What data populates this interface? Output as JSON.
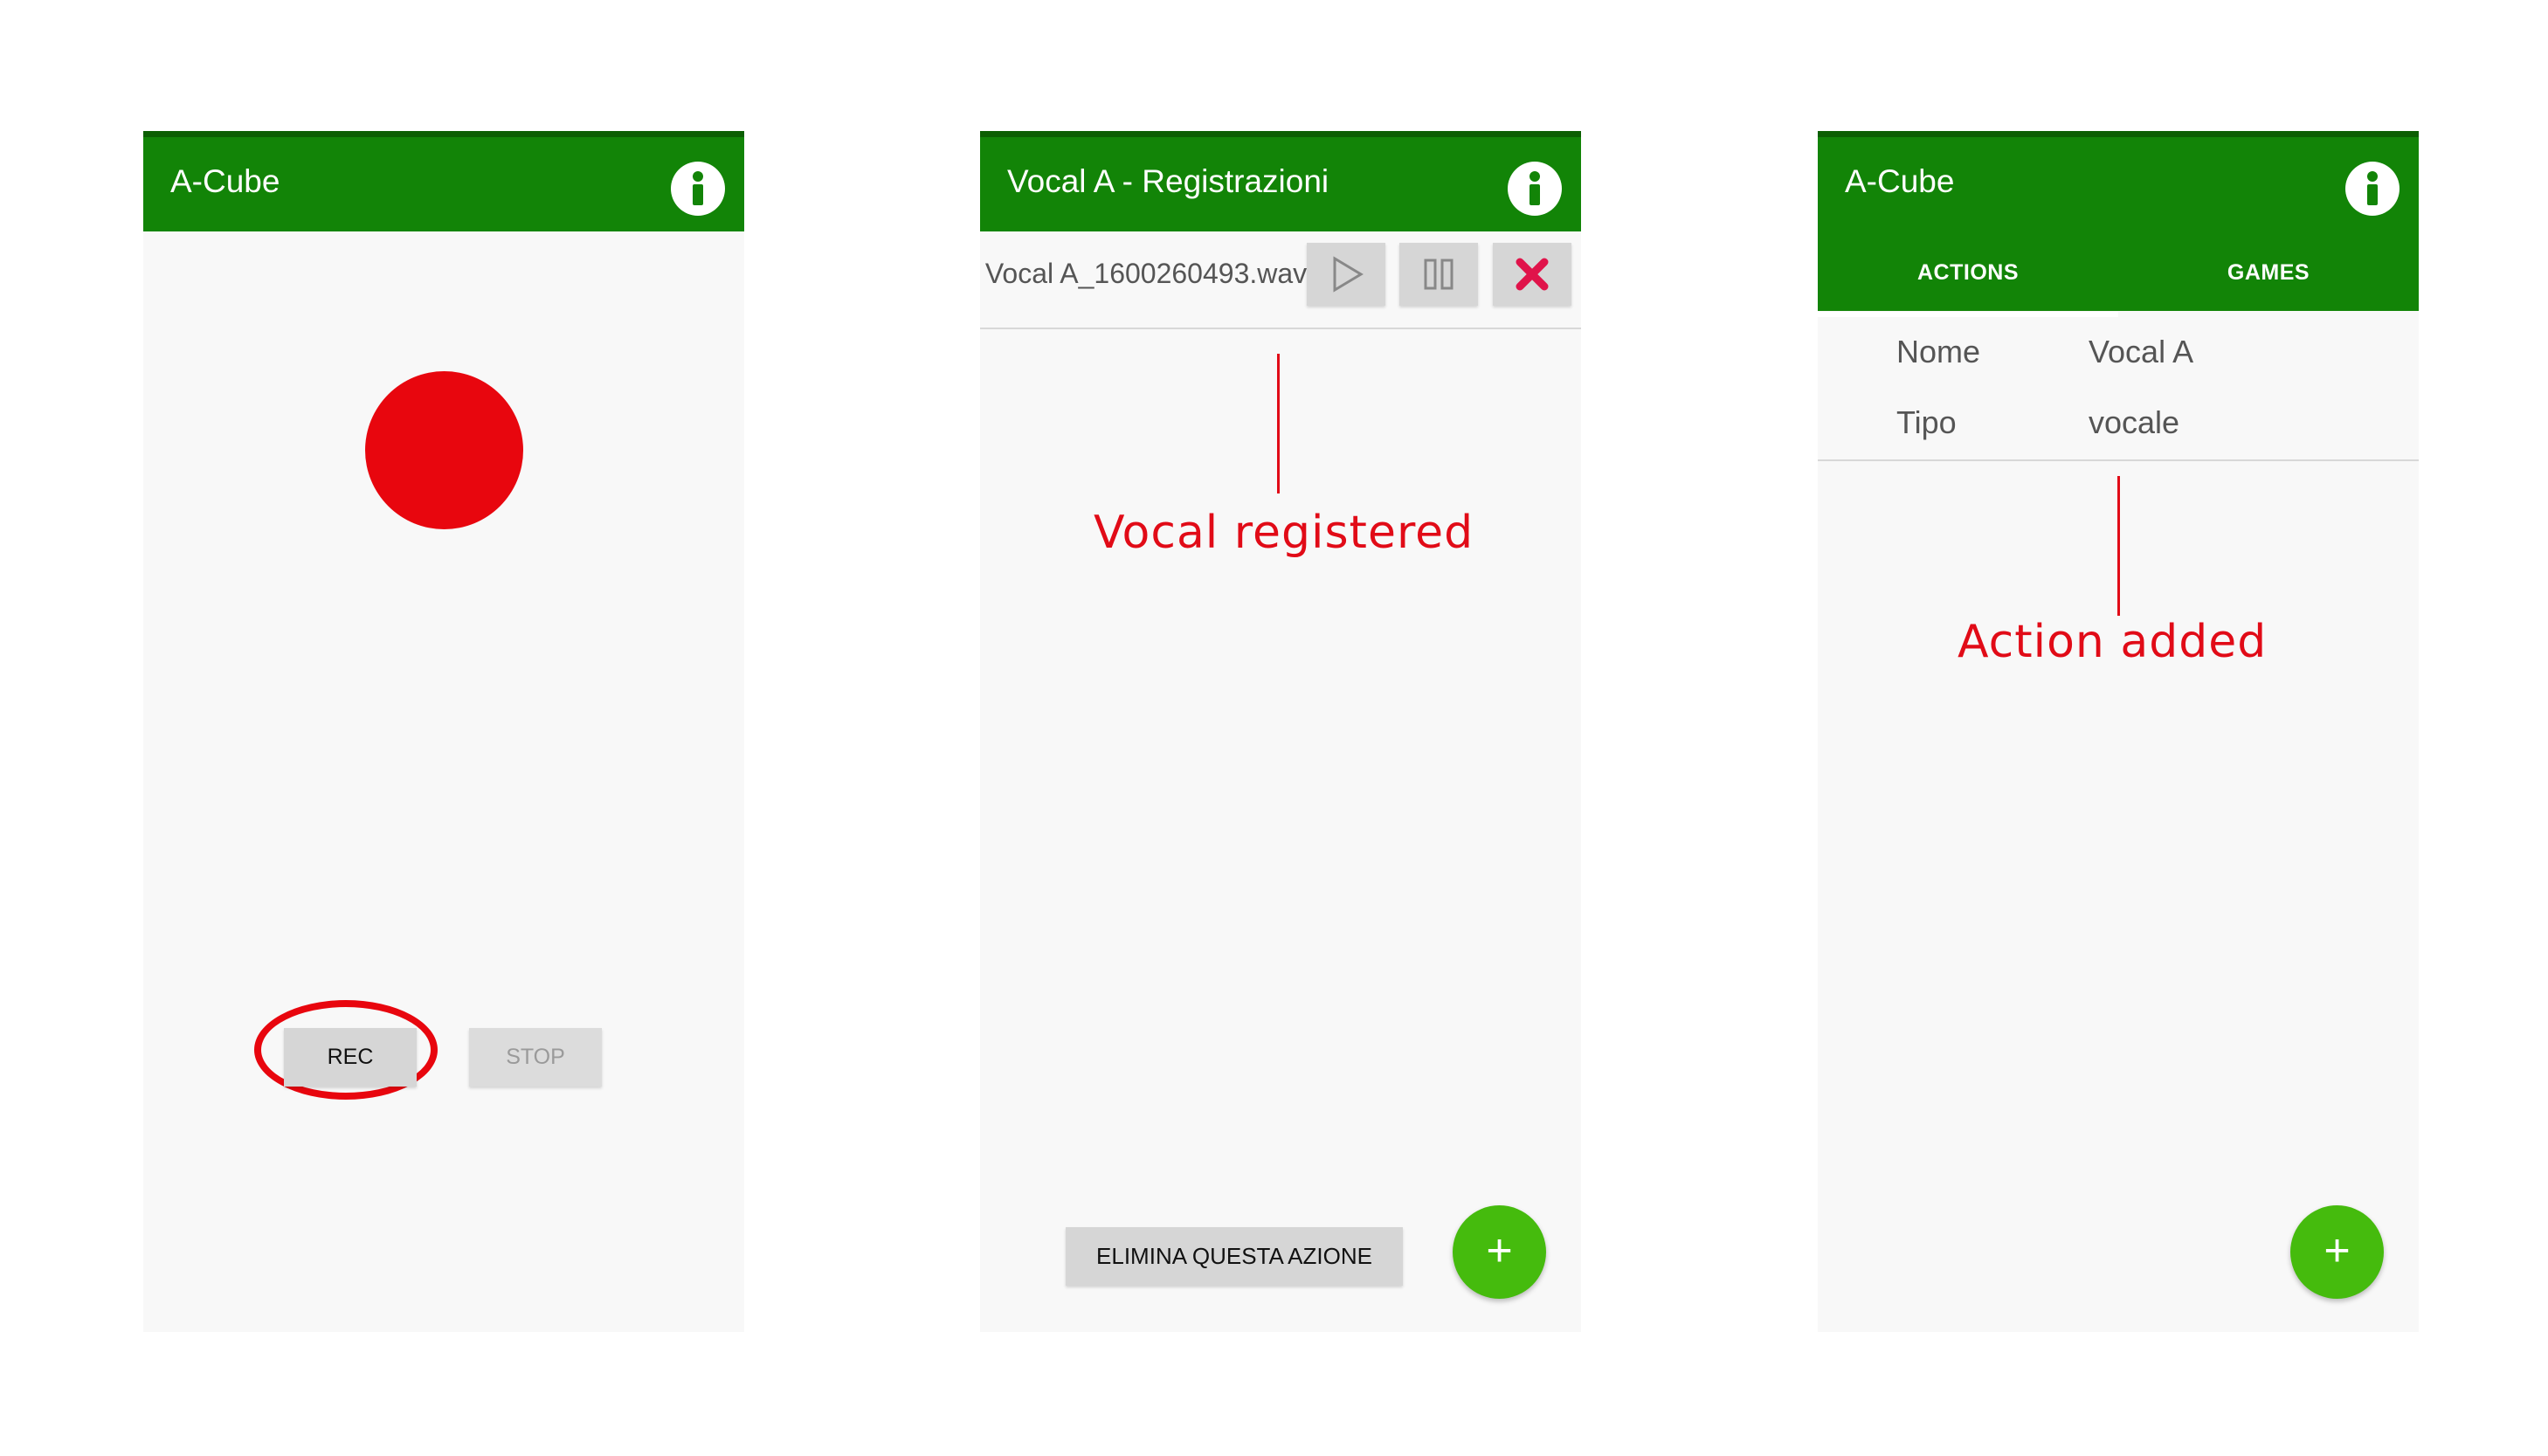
{
  "phones": {
    "recorder": {
      "title": "A-Cube",
      "info_icon": "info-icon",
      "rec_label": "REC",
      "stop_label": "STOP"
    },
    "recordings": {
      "title": "Vocal A - Registrazioni",
      "info_icon": "info-icon",
      "file_name": "Vocal A_1600260493.wav",
      "play_icon": "play-icon",
      "pause_icon": "pause-icon",
      "delete_icon": "close-icon",
      "delete_action_label": "ELIMINA QUESTA AZIONE",
      "fab_label": "+",
      "annotation": "Vocal registered"
    },
    "actions": {
      "title": "A-Cube",
      "info_icon": "info-icon",
      "tabs": [
        {
          "label": "ACTIONS",
          "selected": true
        },
        {
          "label": "GAMES",
          "selected": false
        }
      ],
      "properties": [
        {
          "key": "Nome",
          "value": "Vocal A"
        },
        {
          "key": "Tipo",
          "value": "vocale"
        }
      ],
      "fab_label": "+",
      "annotation": "Action added"
    }
  },
  "colors": {
    "appbar": "#128407",
    "appbar_top": "#0c5e03",
    "record": "#e8060e",
    "annotation": "#e10b17",
    "fab": "#45bb0d",
    "delete": "#e0134a"
  }
}
